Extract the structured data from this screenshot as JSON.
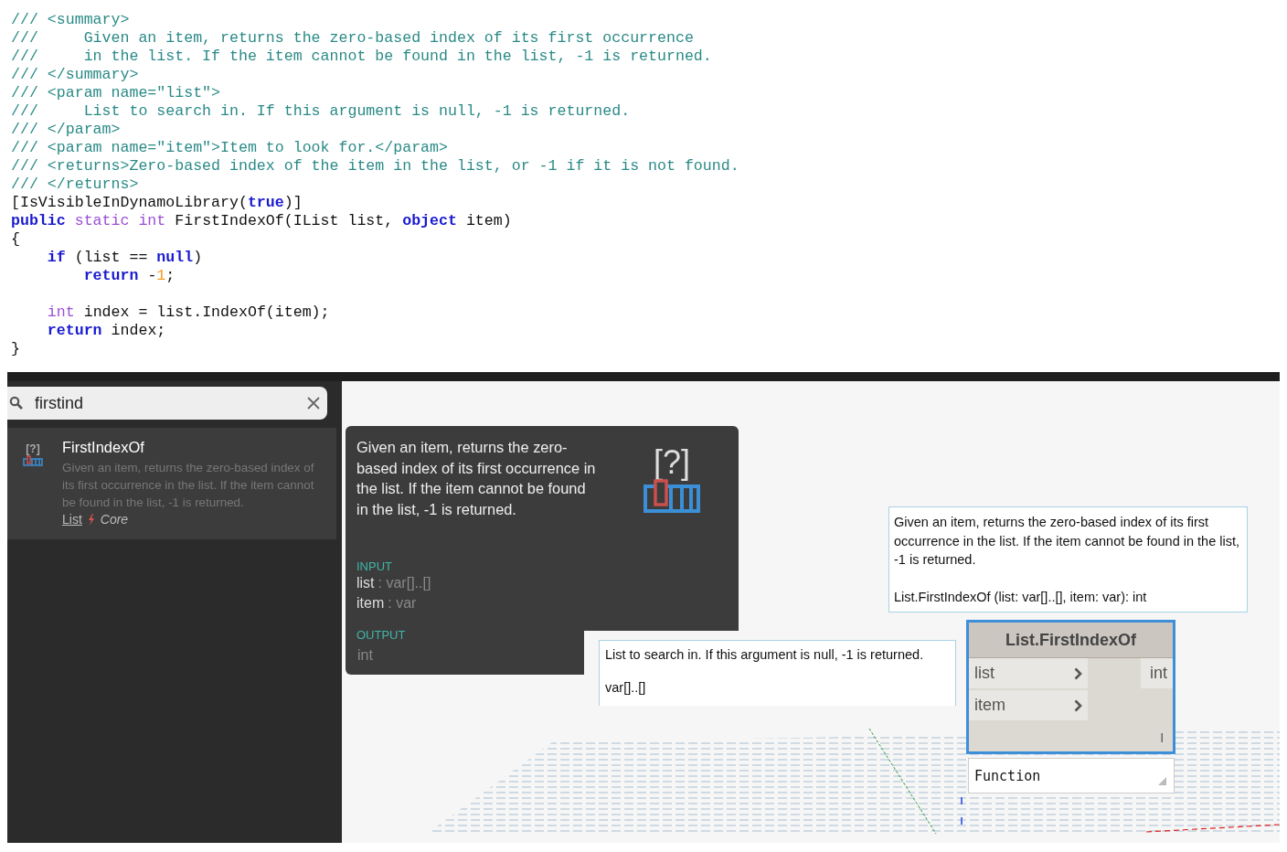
{
  "code": {
    "lines": [
      {
        "tokens": [
          {
            "kind": "comment",
            "text": "/// <summary>"
          }
        ]
      },
      {
        "tokens": [
          {
            "kind": "comment",
            "text": "///     Given an item, returns the zero-based index of its first occurrence"
          }
        ]
      },
      {
        "tokens": [
          {
            "kind": "comment",
            "text": "///     in the list. If the item cannot be found in the list, -1 is returned."
          }
        ]
      },
      {
        "tokens": [
          {
            "kind": "comment",
            "text": "/// </summary>"
          }
        ]
      },
      {
        "tokens": [
          {
            "kind": "comment",
            "text": "/// <param name=\"list\">"
          }
        ]
      },
      {
        "tokens": [
          {
            "kind": "comment",
            "text": "///     List to search in. If this argument is null, -1 is returned."
          }
        ]
      },
      {
        "tokens": [
          {
            "kind": "comment",
            "text": "/// </param>"
          }
        ]
      },
      {
        "tokens": [
          {
            "kind": "comment",
            "text": "/// <param name=\"item\">Item to look for.</param>"
          }
        ]
      },
      {
        "tokens": [
          {
            "kind": "comment",
            "text": "/// <returns>Zero-based index of the item in the list, or -1 if it is not found."
          }
        ]
      },
      {
        "tokens": [
          {
            "kind": "comment",
            "text": "/// </returns>"
          }
        ]
      },
      {
        "tokens": [
          {
            "kind": "plain",
            "text": "[IsVisibleInDynamoLibrary("
          },
          {
            "kind": "keyword",
            "text": "true"
          },
          {
            "kind": "plain",
            "text": ")]"
          }
        ]
      },
      {
        "tokens": [
          {
            "kind": "keyword",
            "text": "public"
          },
          {
            "kind": "type",
            "text": " static int"
          },
          {
            "kind": "plain",
            "text": " FirstIndexOf(IList list, "
          },
          {
            "kind": "keyword",
            "text": "object"
          },
          {
            "kind": "plain",
            "text": " item)"
          }
        ]
      },
      {
        "tokens": [
          {
            "kind": "plain",
            "text": "{"
          }
        ]
      },
      {
        "tokens": [
          {
            "kind": "keyword",
            "text": "    if"
          },
          {
            "kind": "plain",
            "text": " (list == "
          },
          {
            "kind": "keyword",
            "text": "null"
          },
          {
            "kind": "plain",
            "text": ")"
          }
        ]
      },
      {
        "tokens": [
          {
            "kind": "keyword",
            "text": "        return"
          },
          {
            "kind": "plain",
            "text": " -"
          },
          {
            "kind": "number",
            "text": "1"
          },
          {
            "kind": "plain",
            "text": ";"
          }
        ]
      },
      {
        "kind": "blank"
      },
      {
        "tokens": [
          {
            "kind": "type",
            "text": "    int"
          },
          {
            "kind": "plain",
            "text": " index = list.IndexOf(item);"
          }
        ]
      },
      {
        "tokens": [
          {
            "kind": "keyword",
            "text": "    return"
          },
          {
            "kind": "plain",
            "text": " index;"
          }
        ]
      },
      {
        "tokens": [
          {
            "kind": "plain",
            "text": "}"
          }
        ]
      }
    ]
  },
  "library": {
    "search": {
      "value": "firstind"
    },
    "results": [
      {
        "icon_text": "[?]",
        "title": "FirstIndexOf",
        "description": "Given an item, returns the zero-based index of its first occurrence in the list. If the item cannot be found in the list, -1 is returned.",
        "category": "List",
        "group": "Core"
      }
    ]
  },
  "canvas": {
    "info_tooltip": {
      "description": "Given an item, returns the zero-based index of its first occurrence in the list. If the item cannot be found in the list, -1 is returned.",
      "icon_text": "[?]",
      "input_heading": "INPUT",
      "inputs": [
        {
          "name": "list",
          "type": ": var[]..[]"
        },
        {
          "name": "item",
          "type": ": var"
        }
      ],
      "output_heading": "OUTPUT",
      "output": "int"
    },
    "param_tooltip": {
      "description": "List to search in. If this argument is null, -1 is returned.",
      "type": "var[]..[]"
    },
    "node_tooltip": {
      "description": "Given an item, returns the zero-based index of its first occurrence in the list. If the item cannot be found in the list, -1 is returned.",
      "signature": "List.FirstIndexOf (list: var[]..[], item: var): int"
    },
    "node": {
      "title": "List.FirstIndexOf",
      "selected": true,
      "inputs": [
        "list",
        "item"
      ],
      "output": "int"
    },
    "node_type": {
      "value": "Function"
    }
  }
}
